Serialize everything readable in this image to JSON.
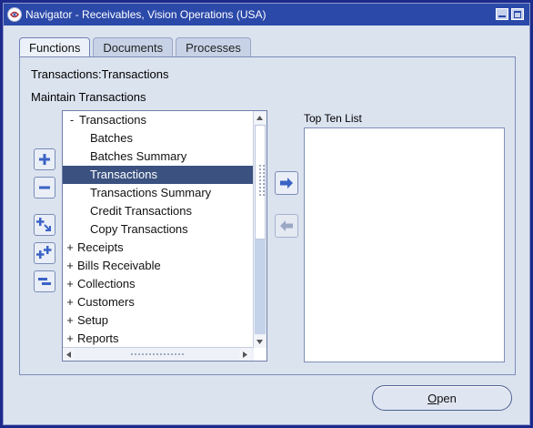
{
  "window": {
    "title": "Navigator - Receivables, Vision Operations (USA)"
  },
  "tabs": [
    {
      "label": "Functions",
      "active": true
    },
    {
      "label": "Documents",
      "active": false
    },
    {
      "label": "Processes",
      "active": false
    }
  ],
  "breadcrumb": "Transactions:Transactions",
  "description": "Maintain Transactions",
  "tree": {
    "items": [
      {
        "sign": "-",
        "label": "Transactions",
        "level": 0,
        "selected": false
      },
      {
        "sign": "",
        "label": "Batches",
        "level": 1,
        "selected": false
      },
      {
        "sign": "",
        "label": "Batches Summary",
        "level": 1,
        "selected": false
      },
      {
        "sign": "",
        "label": "Transactions",
        "level": 1,
        "selected": true
      },
      {
        "sign": "",
        "label": "Transactions Summary",
        "level": 1,
        "selected": false
      },
      {
        "sign": "",
        "label": "Credit Transactions",
        "level": 1,
        "selected": false
      },
      {
        "sign": "",
        "label": "Copy Transactions",
        "level": 1,
        "selected": false
      },
      {
        "sign": "+",
        "label": "Receipts",
        "level": 0,
        "selected": false
      },
      {
        "sign": "+",
        "label": "Bills Receivable",
        "level": 0,
        "selected": false
      },
      {
        "sign": "+",
        "label": "Collections",
        "level": 0,
        "selected": false
      },
      {
        "sign": "+",
        "label": "Customers",
        "level": 0,
        "selected": false
      },
      {
        "sign": "+",
        "label": "Setup",
        "level": 0,
        "selected": false
      },
      {
        "sign": "+",
        "label": "Reports",
        "level": 0,
        "selected": false
      }
    ]
  },
  "top_ten": {
    "label": "Top Ten List"
  },
  "buttons": {
    "open_underlined": "O",
    "open_rest": "pen"
  },
  "colors": {
    "window_frame": "#1c2a8c",
    "title_bar": "#2b49a9",
    "background": "#dbe3ef",
    "selection": "#3b5280",
    "arrow_blue": "#3a63c5"
  }
}
